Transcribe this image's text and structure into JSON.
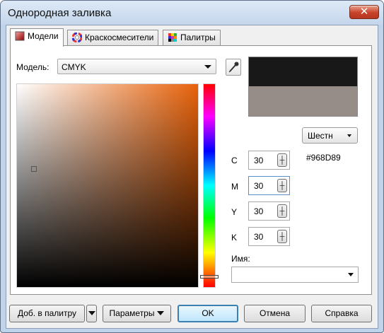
{
  "window": {
    "title": "Однородная заливка",
    "close_glyph": "✕"
  },
  "tabs": [
    {
      "label": "Модели",
      "icon": "models-icon"
    },
    {
      "label": "Краскосмесители",
      "icon": "color-wheel-icon"
    },
    {
      "label": "Палитры",
      "icon": "palette-grid-icon"
    }
  ],
  "model": {
    "label": "Модель:",
    "value": "CMYK"
  },
  "preview": {
    "old_color": "#181818",
    "new_color": "#968D89"
  },
  "hex": {
    "mode": "Шестн",
    "value": "#968D89"
  },
  "channels": [
    {
      "label": "C",
      "value": "30"
    },
    {
      "label": "M",
      "value": "30"
    },
    {
      "label": "Y",
      "value": "30"
    },
    {
      "label": "K",
      "value": "30"
    }
  ],
  "name": {
    "label": "Имя:",
    "value": ""
  },
  "buttons": {
    "add_to_palette": "Доб. в палитру",
    "parameters": "Параметры",
    "ok": "OK",
    "cancel": "Отмена",
    "help": "Справка"
  },
  "colors": {
    "picker_hue": "#e8620a",
    "accent": "#3c7fb1"
  }
}
